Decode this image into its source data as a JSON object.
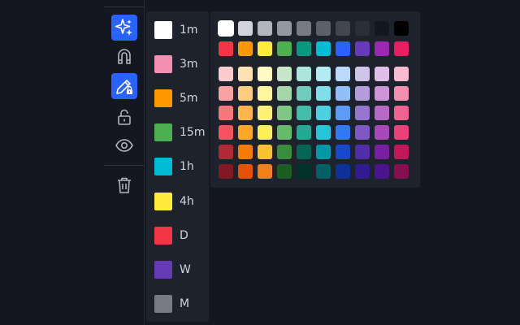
{
  "toolbar": {
    "tools": [
      {
        "id": "magic",
        "icon": "sparkles-icon",
        "active": true
      },
      {
        "id": "magnet",
        "icon": "magnet-icon",
        "active": false
      },
      {
        "id": "drawing-lock",
        "icon": "pencil-lock-icon",
        "active": true
      },
      {
        "id": "lock",
        "icon": "unlock-icon",
        "active": false
      },
      {
        "id": "visibility",
        "icon": "eye-icon",
        "active": false
      },
      {
        "id": "delete",
        "icon": "trash-icon",
        "active": false
      }
    ]
  },
  "intervals": [
    {
      "label": "1m",
      "color": "#ffffff"
    },
    {
      "label": "3m",
      "color": "#f48fb1"
    },
    {
      "label": "5m",
      "color": "#ff9800"
    },
    {
      "label": "15m",
      "color": "#4caf50"
    },
    {
      "label": "1h",
      "color": "#00bcd4"
    },
    {
      "label": "4h",
      "color": "#ffeb3b"
    },
    {
      "label": "D",
      "color": "#f23645"
    },
    {
      "label": "W",
      "color": "#673ab7"
    },
    {
      "label": "M",
      "color": "#787b86"
    }
  ],
  "palette": {
    "selected": "#ffffff",
    "rows": [
      [
        "#ffffff",
        "#d1d4dc",
        "#b2b5be",
        "#9598a1",
        "#787b86",
        "#5d606b",
        "#434651",
        "#2a2e39",
        "#131722",
        "#000000"
      ],
      [
        "#f23645",
        "#ff9800",
        "#ffeb3b",
        "#4caf50",
        "#089981",
        "#00bcd4",
        "#2962ff",
        "#673ab7",
        "#9c27b0",
        "#e91e63"
      ],
      [
        "#fccbcd",
        "#ffe0b2",
        "#fff9c4",
        "#c8e6c9",
        "#ace5dc",
        "#b2ebf2",
        "#bbd9fb",
        "#d1c4e9",
        "#e1bee7",
        "#f8bbd0"
      ],
      [
        "#faa1a4",
        "#ffcc80",
        "#fff59d",
        "#a5d6a7",
        "#70ccbd",
        "#80deea",
        "#90bff9",
        "#b39ddb",
        "#ce93d8",
        "#f48fb1"
      ],
      [
        "#f7787b",
        "#ffb74d",
        "#fff176",
        "#81c784",
        "#42bda8",
        "#4dd0e1",
        "#5b9cf6",
        "#9575cd",
        "#ba68c8",
        "#f06292"
      ],
      [
        "#f7525f",
        "#ffa726",
        "#ffee58",
        "#66bb6a",
        "#22ab94",
        "#26c6da",
        "#3179f5",
        "#7e57c2",
        "#ab47bc",
        "#ec407a"
      ],
      [
        "#b22833",
        "#f57c00",
        "#fbc02d",
        "#388e3c",
        "#056656",
        "#0097a7",
        "#1848cc",
        "#512da8",
        "#7b1fa2",
        "#c2185b"
      ],
      [
        "#801922",
        "#e65100",
        "#f57f17",
        "#1b5e20",
        "#00332a",
        "#006064",
        "#0c3299",
        "#311b92",
        "#4a148c",
        "#880e4f"
      ]
    ]
  }
}
